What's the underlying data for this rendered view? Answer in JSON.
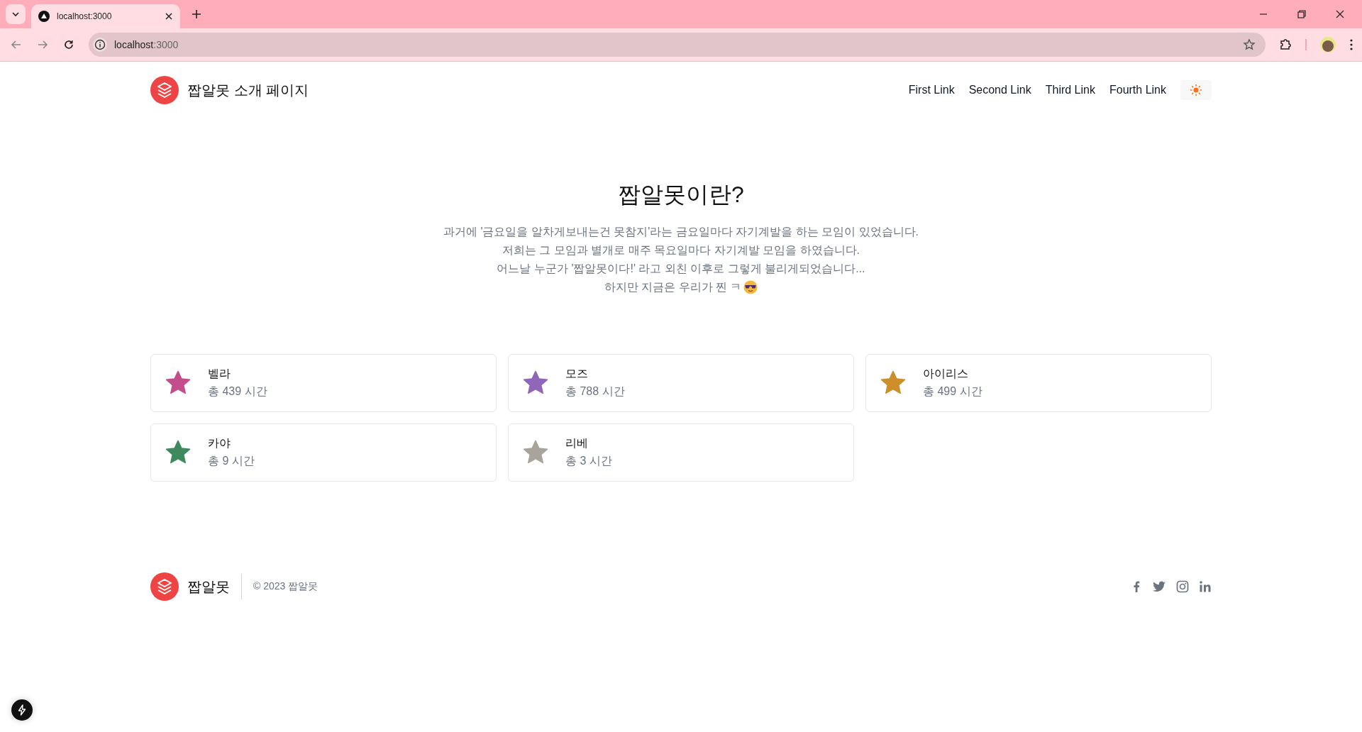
{
  "browser": {
    "tab_title": "localhost:3000",
    "address": {
      "host": "localhost",
      "port": ":3000"
    }
  },
  "header": {
    "logo_text": "짭알못 소개 페이지",
    "links": [
      {
        "label": "First Link"
      },
      {
        "label": "Second Link"
      },
      {
        "label": "Third Link"
      },
      {
        "label": "Fourth Link"
      }
    ]
  },
  "intro": {
    "title": "짭알못이란?",
    "lines": [
      "과거에 '금요일을 알차게보내는건 못참지'라는 금요일마다 자기계발을 하는 모임이 있었습니다.",
      "저희는 그 모임과 별개로 매주 목요일마다 자기계발 모임을 하였습니다.",
      "어느날 누군가 '짭알못이다!' 라고 외친 이후로 그렇게 불리게되었습니다...",
      "하지만 지금은 우리가 찐 ㅋ"
    ]
  },
  "members": [
    {
      "name": "벨라",
      "hours": "총 439 시간",
      "color": "#c44d8b"
    },
    {
      "name": "모즈",
      "hours": "총 788 시간",
      "color": "#9066b8"
    },
    {
      "name": "아이리스",
      "hours": "총 499 시간",
      "color": "#cc8f2c"
    },
    {
      "name": "카야",
      "hours": "총 9 시간",
      "color": "#3e8a5e"
    },
    {
      "name": "리베",
      "hours": "총 3 시간",
      "color": "#a8a39b"
    }
  ],
  "footer": {
    "logo_text": "짭알못",
    "copyright": "© 2023 짭알못"
  }
}
